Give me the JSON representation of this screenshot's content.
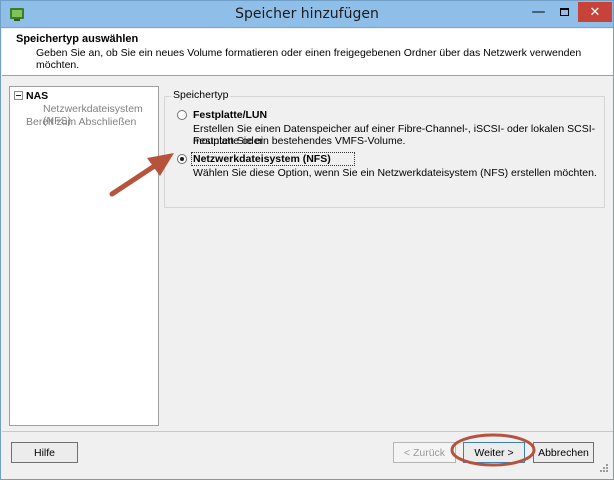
{
  "window": {
    "title": "Speicher hinzufügen",
    "controls": {
      "minimize": "—",
      "close": "✕"
    }
  },
  "header": {
    "title": "Speichertyp auswählen",
    "description": "Geben Sie an, ob Sie ein neues Volume formatieren oder einen freigegebenen Ordner über das Netzwerk verwenden möchten."
  },
  "sidebar": {
    "items": [
      {
        "label": "NAS"
      },
      {
        "label": "Netzwerkdateisystem (NFS)"
      },
      {
        "label": "Bereit zum Abschließen"
      }
    ]
  },
  "storage_type": {
    "legend": "Speichertyp",
    "options": [
      {
        "label": "Festplatte/LUN",
        "description_line1": "Erstellen Sie einen Datenspeicher auf einer Fibre-Channel-, iSCSI- oder lokalen SCSI-Festplatte oder",
        "description_line2": "mounten Sie ein bestehendes VMFS-Volume.",
        "selected": false
      },
      {
        "label": "Netzwerkdateisystem (NFS)",
        "description_line1": "Wählen Sie diese Option, wenn Sie ein Netzwerkdateisystem (NFS) erstellen möchten.",
        "selected": true
      }
    ]
  },
  "footer": {
    "help": "Hilfe",
    "back": "< Zurück",
    "next": "Weiter >",
    "cancel": "Abbrechen"
  },
  "colors": {
    "titlebar": "#8fbfe9",
    "close_button": "#c7433a",
    "annotation": "#b5533c"
  }
}
